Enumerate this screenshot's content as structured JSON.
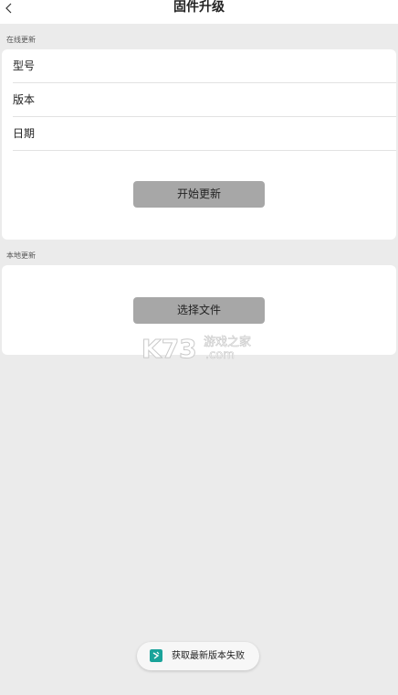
{
  "header": {
    "title": "固件升级",
    "back_icon": "chevron-left-icon"
  },
  "online_update": {
    "label": "在线更新",
    "rows": [
      {
        "label": "型号"
      },
      {
        "label": "版本"
      },
      {
        "label": "日期"
      }
    ],
    "start_button": "开始更新"
  },
  "local_update": {
    "label": "本地更新",
    "select_button": "选择文件"
  },
  "watermark": {
    "brand": "K73",
    "tagline": "游戏之家",
    "domain": ".com"
  },
  "toast": {
    "icon": "app-logo-icon",
    "message": "获取最新版本失败",
    "icon_color": "#1aa39a"
  },
  "colors": {
    "background": "#ebebeb",
    "card": "#ffffff",
    "button": "#a7a7a7"
  }
}
